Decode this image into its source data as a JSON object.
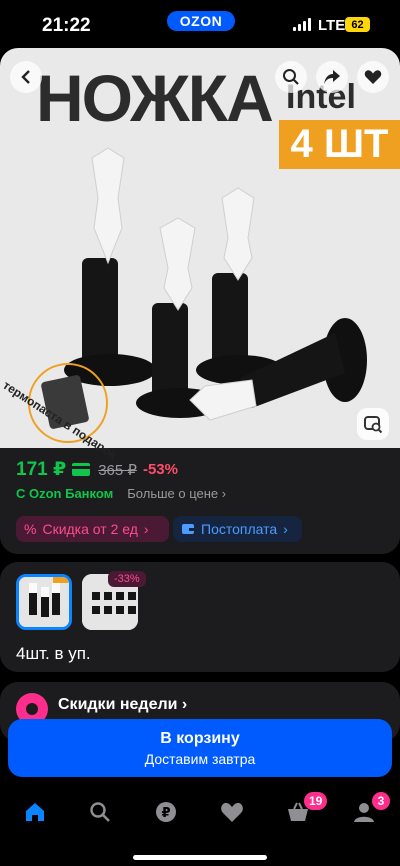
{
  "status": {
    "time": "21:22",
    "network": "LTE",
    "battery": "62",
    "app_badge": "OZON"
  },
  "product": {
    "image_title": "НОЖКА",
    "image_subtitle": "Intel",
    "image_qty": "4 ШТ",
    "gift_text": "термопаста в подарок",
    "price_now": "171 ₽",
    "price_old": "365 ₽",
    "discount": "-53%",
    "bank_label": "С Ozon Банком",
    "more_price": "Больше о цене",
    "chip_discount": "Скидка от 2 ед",
    "chip_postpay": "Постоплата"
  },
  "variants": {
    "badge": "-33%",
    "pack_label": "4шт. в уп."
  },
  "promo": {
    "title": "Скидки недели"
  },
  "cart": {
    "label": "В корзину",
    "sub": "Доставим завтра"
  },
  "tabs": {
    "cart_badge": "19",
    "profile_badge": "3"
  },
  "colors": {
    "accent": "#005bff",
    "price": "#10c44c",
    "discount": "#ff4c6a",
    "badge": "#ff2d8c"
  }
}
